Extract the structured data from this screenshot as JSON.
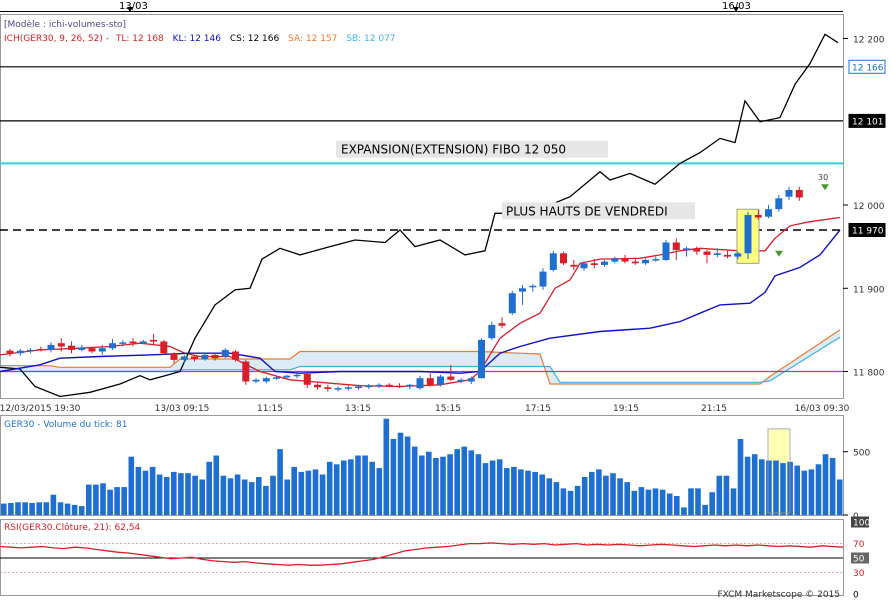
{
  "header": {
    "model_label": "[Modèle : ichi-volumes-sto]",
    "ich_label": "ICH(GER30, 9, 26, 52) -",
    "tl_label": "TL: 12 168",
    "kl_label": "KL: 12 146",
    "cs_label": "CS: 12 166",
    "sa_label": "SA: 12 157",
    "sb_label": "SB: 12 077"
  },
  "top_dates": [
    "13/03",
    "16/03"
  ],
  "footer": {
    "copyright": "FXCM Marketscope © 2015"
  },
  "colors": {
    "up_candle": "#1f6fd0",
    "down_candle": "#d81e28",
    "tenkan": "#d81e28",
    "kijun": "#1010c8",
    "chikou": "#000000",
    "span_a": "#f07830",
    "span_b": "#40b0e0",
    "cloud": "#dcecf7",
    "fibo_line": "#30d0e0",
    "volume": "#1f6fd0",
    "highlight": "#ffff80",
    "rsi": "#d81e28",
    "purple_line": "#a040c0"
  },
  "chart_data": [
    {
      "type": "candlestick",
      "price_axis": {
        "ticks": [
          "12 200",
          "12 000",
          "11 900",
          "11 800"
        ],
        "ylim": [
          11780,
          12215
        ]
      },
      "x_labels": [
        "12/03/2015 19:30",
        "13/03 09:15",
        "11:15",
        "13:15",
        "15:15",
        "17:15",
        "19:15",
        "21:15",
        "16/03 09:30"
      ],
      "price_tags": [
        {
          "label": "12 166",
          "value": 12166,
          "style": "blue"
        },
        {
          "label": "12 101",
          "value": 12101,
          "style": "black"
        },
        {
          "label": "11 970",
          "value": 11970,
          "style": "black"
        }
      ],
      "horizontal_lines": [
        {
          "value": 12166,
          "style": "solid"
        },
        {
          "value": 12101,
          "style": "solid"
        },
        {
          "value": 12050,
          "style": "fibo"
        },
        {
          "value": 11970,
          "style": "dashed"
        },
        {
          "value": 11800,
          "style": "purple"
        }
      ],
      "annotations": [
        {
          "text": "EXPANSION(EXTENSION) FIBO 12 050",
          "value": 12064
        },
        {
          "text": "PLUS HAUTS DE VENDREDI",
          "value": 11990
        },
        {
          "text": "30",
          "value": 12030
        }
      ],
      "candles": [
        [
          11825,
          11827,
          11818,
          11822
        ],
        [
          11822,
          11827,
          11819,
          11825
        ],
        [
          11825,
          11828,
          11822,
          11826
        ],
        [
          11827,
          11830,
          11824,
          11826
        ],
        [
          11826,
          11835,
          11823,
          11832
        ],
        [
          11834,
          11840,
          11824,
          11830
        ],
        [
          11831,
          11836,
          11822,
          11826
        ],
        [
          11826,
          11832,
          11824,
          11829
        ],
        [
          11828,
          11829,
          11822,
          11824
        ],
        [
          11824,
          11832,
          11820,
          11828
        ],
        [
          11828,
          11839,
          11826,
          11834
        ],
        [
          11834,
          11838,
          11830,
          11835
        ],
        [
          11836,
          11840,
          11830,
          11834
        ],
        [
          11834,
          11838,
          11833,
          11836
        ],
        [
          11838,
          11845,
          11832,
          11836
        ],
        [
          11836,
          11838,
          11820,
          11822
        ],
        [
          11822,
          11823,
          11810,
          11814
        ],
        [
          11814,
          11820,
          11810,
          11818
        ],
        [
          11818,
          11820,
          11812,
          11815
        ],
        [
          11815,
          11822,
          11813,
          11820
        ],
        [
          11820,
          11822,
          11813,
          11816
        ],
        [
          11818,
          11828,
          11816,
          11826
        ],
        [
          11824,
          11826,
          11812,
          11814
        ],
        [
          11812,
          11814,
          11784,
          11788
        ],
        [
          11788,
          11792,
          11786,
          11790
        ],
        [
          11788,
          11794,
          11786,
          11792
        ],
        [
          11792,
          11795,
          11790,
          11793
        ],
        [
          11793,
          11796,
          11791,
          11795
        ],
        [
          11795,
          11798,
          11792,
          11796
        ],
        [
          11797,
          11798,
          11780,
          11784
        ],
        [
          11784,
          11786,
          11778,
          11781
        ],
        [
          11781,
          11784,
          11776,
          11779
        ],
        [
          11779,
          11782,
          11776,
          11780
        ],
        [
          11780,
          11783,
          11777,
          11781
        ],
        [
          11781,
          11784,
          11778,
          11782
        ],
        [
          11782,
          11785,
          11779,
          11783
        ],
        [
          11783,
          11786,
          11780,
          11784
        ],
        [
          11784,
          11786,
          11781,
          11783
        ],
        [
          11783,
          11786,
          11780,
          11782
        ],
        [
          11782,
          11785,
          11779,
          11784
        ],
        [
          11780,
          11795,
          11778,
          11792
        ],
        [
          11792,
          11798,
          11782,
          11784
        ],
        [
          11784,
          11796,
          11782,
          11794
        ],
        [
          11794,
          11808,
          11788,
          11790
        ],
        [
          11789,
          11792,
          11786,
          11790
        ],
        [
          11788,
          11794,
          11785,
          11792
        ],
        [
          11792,
          11840,
          11792,
          11838
        ],
        [
          11840,
          11860,
          11838,
          11856
        ],
        [
          11858,
          11865,
          11852,
          11855
        ],
        [
          11870,
          11897,
          11868,
          11894
        ],
        [
          11896,
          11904,
          11880,
          11900
        ],
        [
          11902,
          11905,
          11896,
          11903
        ],
        [
          11902,
          11924,
          11898,
          11920
        ],
        [
          11922,
          11945,
          11920,
          11942
        ],
        [
          11942,
          11944,
          11928,
          11930
        ],
        [
          11928,
          11934,
          11922,
          11926
        ],
        [
          11924,
          11932,
          11921,
          11930
        ],
        [
          11930,
          11935,
          11924,
          11928
        ],
        [
          11928,
          11934,
          11926,
          11932
        ],
        [
          11932,
          11938,
          11930,
          11936
        ],
        [
          11936,
          11940,
          11930,
          11932
        ],
        [
          11932,
          11937,
          11928,
          11930
        ],
        [
          11930,
          11936,
          11928,
          11934
        ],
        [
          11934,
          11938,
          11932,
          11935
        ],
        [
          11934,
          11958,
          11933,
          11955
        ],
        [
          11955,
          11960,
          11934,
          11946
        ],
        [
          11946,
          11950,
          11938,
          11948
        ],
        [
          11948,
          11950,
          11940,
          11944
        ],
        [
          11944,
          11946,
          11930,
          11940
        ],
        [
          11940,
          11948,
          11937,
          11942
        ],
        [
          11940,
          11945,
          11936,
          11938
        ],
        [
          11938,
          11944,
          11935,
          11942
        ],
        [
          11942,
          11992,
          11935,
          11988
        ],
        [
          11988,
          11994,
          11982,
          11985
        ],
        [
          11986,
          12000,
          11984,
          11995
        ],
        [
          11995,
          12012,
          11992,
          12008
        ],
        [
          12010,
          12022,
          12006,
          12018
        ],
        [
          12018,
          12022,
          12005,
          12009
        ]
      ],
      "highlight_candle": 72
    },
    {
      "type": "bar",
      "title": "GER30 - Volume du tick: 81",
      "y_ticks": [
        "500",
        "0"
      ],
      "ylim": [
        0,
        750
      ],
      "values": [
        90,
        95,
        100,
        100,
        95,
        100,
        100,
        160,
        100,
        90,
        80,
        70,
        240,
        240,
        250,
        200,
        220,
        220,
        460,
        380,
        350,
        380,
        320,
        300,
        340,
        330,
        330,
        310,
        280,
        420,
        470,
        310,
        290,
        320,
        280,
        260,
        300,
        230,
        310,
        520,
        280,
        380,
        340,
        350,
        360,
        320,
        420,
        400,
        430,
        440,
        470,
        470,
        420,
        370,
        760,
        600,
        650,
        620,
        540,
        470,
        500,
        450,
        460,
        480,
        520,
        540,
        510,
        480,
        410,
        430,
        440,
        370,
        380,
        360,
        350,
        340,
        320,
        290,
        260,
        210,
        190,
        230,
        300,
        340,
        360,
        310,
        330,
        290,
        260,
        190,
        220,
        200,
        210,
        200,
        170,
        150,
        60,
        210,
        210,
        80,
        180,
        310,
        310,
        210,
        600,
        460,
        480,
        440,
        430,
        430,
        410,
        420,
        390,
        350,
        360,
        400,
        480,
        450,
        280
      ]
    },
    {
      "type": "line",
      "title": "RSI(GER30.Clôture, 21): 62,54",
      "y_ticks": [
        "100",
        "70",
        "50",
        "30",
        "0"
      ],
      "ylim": [
        0,
        100
      ],
      "values": [
        66,
        65,
        64,
        65,
        66,
        64,
        63,
        65,
        64,
        62,
        60,
        58,
        57,
        55,
        53,
        51,
        49,
        50,
        51,
        48,
        46,
        45,
        44,
        45,
        43,
        42,
        41,
        40,
        41,
        40,
        40,
        41,
        42,
        44,
        46,
        48,
        52,
        56,
        60,
        62,
        64,
        65,
        66,
        68,
        70,
        70,
        71,
        70,
        69,
        70,
        69,
        70,
        68,
        69,
        70,
        68,
        69,
        68,
        69,
        68,
        67,
        68,
        69,
        68,
        67,
        66,
        67,
        68,
        67,
        68,
        67,
        68,
        67,
        66,
        67,
        66,
        65,
        67,
        66,
        65
      ]
    }
  ]
}
